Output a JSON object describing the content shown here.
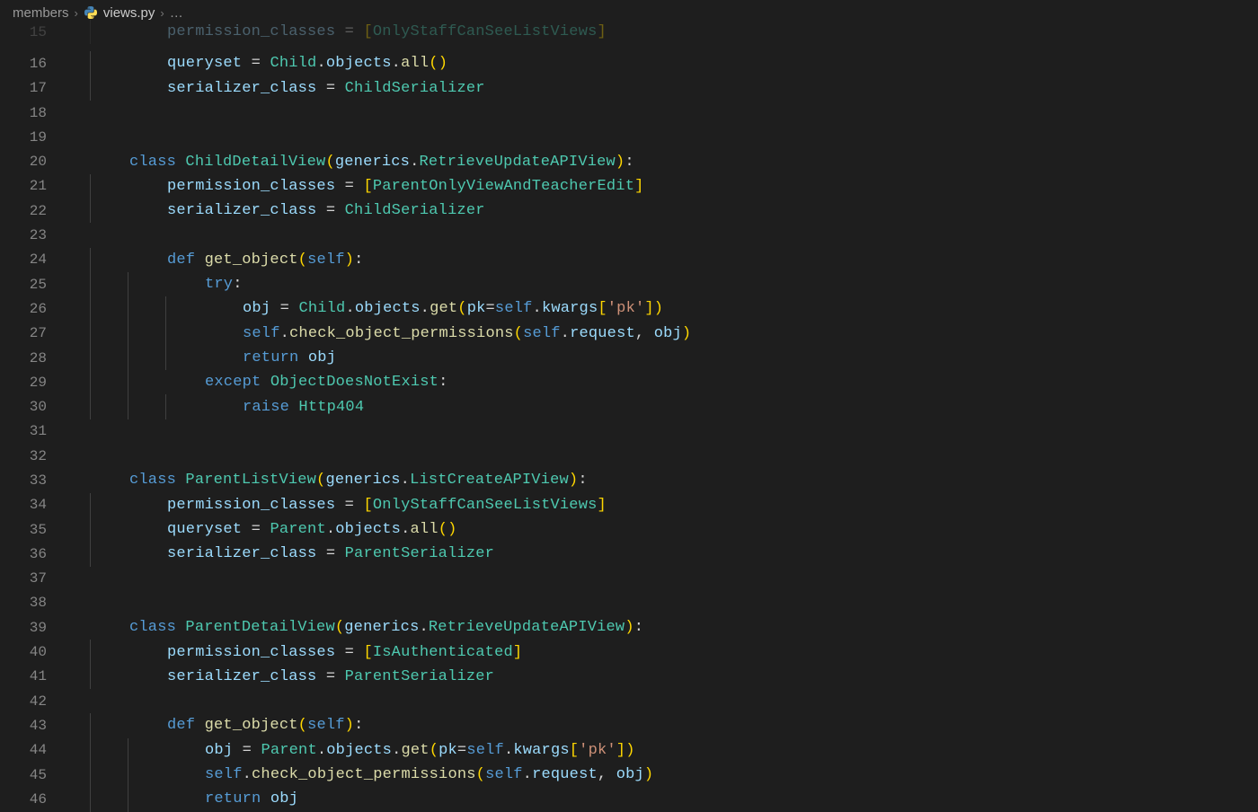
{
  "breadcrumb": {
    "folder": "members",
    "file": "views.py",
    "trail": "…"
  },
  "lines": [
    {
      "n": 15,
      "indent": 2,
      "cut": true,
      "tokens": [
        [
          "var",
          "permission_classes"
        ],
        [
          "op",
          " = "
        ],
        [
          "brkt",
          "["
        ],
        [
          "cls",
          "OnlyStaffCanSeeListViews"
        ],
        [
          "brkt",
          "]"
        ]
      ]
    },
    {
      "n": 16,
      "indent": 2,
      "tokens": [
        [
          "var",
          "queryset"
        ],
        [
          "op",
          " = "
        ],
        [
          "cls",
          "Child"
        ],
        [
          "pkt",
          "."
        ],
        [
          "var",
          "objects"
        ],
        [
          "pkt",
          "."
        ],
        [
          "fn",
          "all"
        ],
        [
          "brkt",
          "()"
        ]
      ]
    },
    {
      "n": 17,
      "indent": 2,
      "tokens": [
        [
          "var",
          "serializer_class"
        ],
        [
          "op",
          " = "
        ],
        [
          "cls",
          "ChildSerializer"
        ]
      ]
    },
    {
      "n": 18,
      "indent": 0,
      "tokens": []
    },
    {
      "n": 19,
      "indent": 0,
      "tokens": []
    },
    {
      "n": 20,
      "indent": 1,
      "tokens": [
        [
          "kw",
          "class"
        ],
        [
          "pkt",
          " "
        ],
        [
          "cls",
          "ChildDetailView"
        ],
        [
          "brkt",
          "("
        ],
        [
          "var",
          "generics"
        ],
        [
          "pkt",
          "."
        ],
        [
          "cls",
          "RetrieveUpdateAPIView"
        ],
        [
          "brkt",
          ")"
        ],
        [
          "pkt",
          ":"
        ]
      ]
    },
    {
      "n": 21,
      "indent": 2,
      "tokens": [
        [
          "var",
          "permission_classes"
        ],
        [
          "op",
          " = "
        ],
        [
          "brkt",
          "["
        ],
        [
          "cls",
          "ParentOnlyViewAndTeacherEdit"
        ],
        [
          "brkt",
          "]"
        ]
      ]
    },
    {
      "n": 22,
      "indent": 2,
      "tokens": [
        [
          "var",
          "serializer_class"
        ],
        [
          "op",
          " = "
        ],
        [
          "cls",
          "ChildSerializer"
        ]
      ]
    },
    {
      "n": 23,
      "indent": 1,
      "tokens": []
    },
    {
      "n": 24,
      "indent": 2,
      "tokens": [
        [
          "kw",
          "def"
        ],
        [
          "pkt",
          " "
        ],
        [
          "fn",
          "get_object"
        ],
        [
          "brkt",
          "("
        ],
        [
          "self",
          "self"
        ],
        [
          "brkt",
          ")"
        ],
        [
          "pkt",
          ":"
        ]
      ]
    },
    {
      "n": 25,
      "indent": 3,
      "tokens": [
        [
          "kw",
          "try"
        ],
        [
          "pkt",
          ":"
        ]
      ]
    },
    {
      "n": 26,
      "indent": 4,
      "tokens": [
        [
          "var",
          "obj"
        ],
        [
          "op",
          " = "
        ],
        [
          "cls",
          "Child"
        ],
        [
          "pkt",
          "."
        ],
        [
          "var",
          "objects"
        ],
        [
          "pkt",
          "."
        ],
        [
          "fn",
          "get"
        ],
        [
          "brkt",
          "("
        ],
        [
          "var",
          "pk"
        ],
        [
          "op",
          "="
        ],
        [
          "self",
          "self"
        ],
        [
          "pkt",
          "."
        ],
        [
          "var",
          "kwargs"
        ],
        [
          "brkt",
          "["
        ],
        [
          "str",
          "'pk'"
        ],
        [
          "brkt",
          "]"
        ],
        [
          "brkt",
          ")"
        ]
      ]
    },
    {
      "n": 27,
      "indent": 4,
      "tokens": [
        [
          "self",
          "self"
        ],
        [
          "pkt",
          "."
        ],
        [
          "fn",
          "check_object_permissions"
        ],
        [
          "brkt",
          "("
        ],
        [
          "self",
          "self"
        ],
        [
          "pkt",
          "."
        ],
        [
          "var",
          "request"
        ],
        [
          "pkt",
          ", "
        ],
        [
          "var",
          "obj"
        ],
        [
          "brkt",
          ")"
        ]
      ]
    },
    {
      "n": 28,
      "indent": 4,
      "tokens": [
        [
          "kw",
          "return"
        ],
        [
          "pkt",
          " "
        ],
        [
          "var",
          "obj"
        ]
      ]
    },
    {
      "n": 29,
      "indent": 3,
      "tokens": [
        [
          "kw",
          "except"
        ],
        [
          "pkt",
          " "
        ],
        [
          "cls",
          "ObjectDoesNotExist"
        ],
        [
          "pkt",
          ":"
        ]
      ]
    },
    {
      "n": 30,
      "indent": 4,
      "tokens": [
        [
          "kw",
          "raise"
        ],
        [
          "pkt",
          " "
        ],
        [
          "cls",
          "Http404"
        ]
      ]
    },
    {
      "n": 31,
      "indent": 0,
      "tokens": []
    },
    {
      "n": 32,
      "indent": 0,
      "tokens": []
    },
    {
      "n": 33,
      "indent": 1,
      "tokens": [
        [
          "kw",
          "class"
        ],
        [
          "pkt",
          " "
        ],
        [
          "cls",
          "ParentListView"
        ],
        [
          "brkt",
          "("
        ],
        [
          "var",
          "generics"
        ],
        [
          "pkt",
          "."
        ],
        [
          "cls",
          "ListCreateAPIView"
        ],
        [
          "brkt",
          ")"
        ],
        [
          "pkt",
          ":"
        ]
      ]
    },
    {
      "n": 34,
      "indent": 2,
      "tokens": [
        [
          "var",
          "permission_classes"
        ],
        [
          "op",
          " = "
        ],
        [
          "brkt",
          "["
        ],
        [
          "cls",
          "OnlyStaffCanSeeListViews"
        ],
        [
          "brkt",
          "]"
        ]
      ]
    },
    {
      "n": 35,
      "indent": 2,
      "tokens": [
        [
          "var",
          "queryset"
        ],
        [
          "op",
          " = "
        ],
        [
          "cls",
          "Parent"
        ],
        [
          "pkt",
          "."
        ],
        [
          "var",
          "objects"
        ],
        [
          "pkt",
          "."
        ],
        [
          "fn",
          "all"
        ],
        [
          "brkt",
          "()"
        ]
      ]
    },
    {
      "n": 36,
      "indent": 2,
      "tokens": [
        [
          "var",
          "serializer_class"
        ],
        [
          "op",
          " = "
        ],
        [
          "cls",
          "ParentSerializer"
        ]
      ]
    },
    {
      "n": 37,
      "indent": 0,
      "tokens": []
    },
    {
      "n": 38,
      "indent": 0,
      "tokens": []
    },
    {
      "n": 39,
      "indent": 1,
      "tokens": [
        [
          "kw",
          "class"
        ],
        [
          "pkt",
          " "
        ],
        [
          "cls",
          "ParentDetailView"
        ],
        [
          "brkt",
          "("
        ],
        [
          "var",
          "generics"
        ],
        [
          "pkt",
          "."
        ],
        [
          "cls",
          "RetrieveUpdateAPIView"
        ],
        [
          "brkt",
          ")"
        ],
        [
          "pkt",
          ":"
        ]
      ]
    },
    {
      "n": 40,
      "indent": 2,
      "tokens": [
        [
          "var",
          "permission_classes"
        ],
        [
          "op",
          " = "
        ],
        [
          "brkt",
          "["
        ],
        [
          "cls",
          "IsAuthenticated"
        ],
        [
          "brkt",
          "]"
        ]
      ]
    },
    {
      "n": 41,
      "indent": 2,
      "tokens": [
        [
          "var",
          "serializer_class"
        ],
        [
          "op",
          " = "
        ],
        [
          "cls",
          "ParentSerializer"
        ]
      ]
    },
    {
      "n": 42,
      "indent": 1,
      "tokens": []
    },
    {
      "n": 43,
      "indent": 2,
      "tokens": [
        [
          "kw",
          "def"
        ],
        [
          "pkt",
          " "
        ],
        [
          "fn",
          "get_object"
        ],
        [
          "brkt",
          "("
        ],
        [
          "self",
          "self"
        ],
        [
          "brkt",
          ")"
        ],
        [
          "pkt",
          ":"
        ]
      ]
    },
    {
      "n": 44,
      "indent": 3,
      "tokens": [
        [
          "var",
          "obj"
        ],
        [
          "op",
          " = "
        ],
        [
          "cls",
          "Parent"
        ],
        [
          "pkt",
          "."
        ],
        [
          "var",
          "objects"
        ],
        [
          "pkt",
          "."
        ],
        [
          "fn",
          "get"
        ],
        [
          "brkt",
          "("
        ],
        [
          "var",
          "pk"
        ],
        [
          "op",
          "="
        ],
        [
          "self",
          "self"
        ],
        [
          "pkt",
          "."
        ],
        [
          "var",
          "kwargs"
        ],
        [
          "brkt",
          "["
        ],
        [
          "str",
          "'pk'"
        ],
        [
          "brkt",
          "]"
        ],
        [
          "brkt",
          ")"
        ]
      ]
    },
    {
      "n": 45,
      "indent": 3,
      "tokens": [
        [
          "self",
          "self"
        ],
        [
          "pkt",
          "."
        ],
        [
          "fn",
          "check_object_permissions"
        ],
        [
          "brkt",
          "("
        ],
        [
          "self",
          "self"
        ],
        [
          "pkt",
          "."
        ],
        [
          "var",
          "request"
        ],
        [
          "pkt",
          ", "
        ],
        [
          "var",
          "obj"
        ],
        [
          "brkt",
          ")"
        ]
      ]
    },
    {
      "n": 46,
      "indent": 3,
      "cutBottom": true,
      "tokens": [
        [
          "kw",
          "return"
        ],
        [
          "pkt",
          " "
        ],
        [
          "var",
          "obj"
        ]
      ]
    }
  ],
  "indentWidth": 42
}
